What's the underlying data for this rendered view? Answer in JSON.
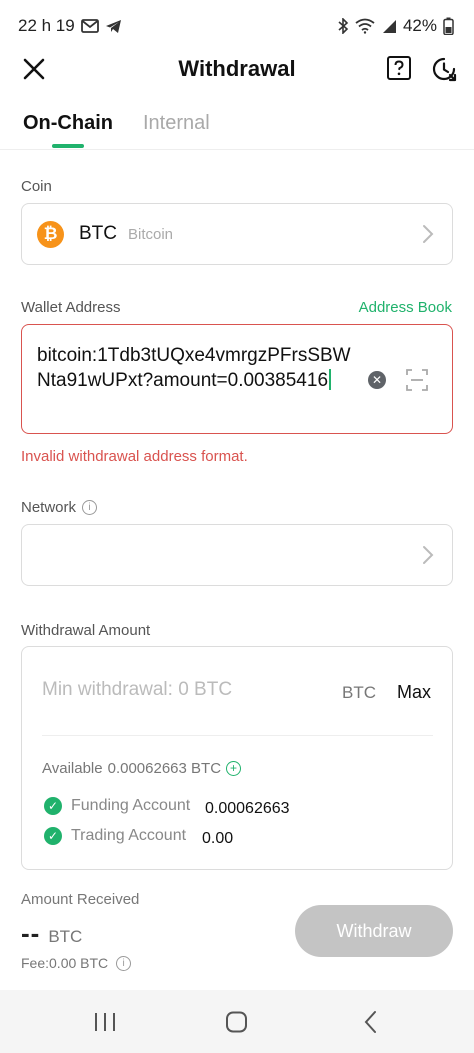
{
  "status_bar": {
    "time": "22 h 19",
    "battery": "42%",
    "left_icons": [
      "gmail-icon",
      "telegram-icon"
    ],
    "right_icons": [
      "bluetooth-icon",
      "wifi-icon",
      "signal-icon",
      "battery-icon"
    ]
  },
  "header": {
    "title": "Withdrawal"
  },
  "tabs": [
    {
      "label": "On-Chain",
      "active": true
    },
    {
      "label": "Internal",
      "active": false
    }
  ],
  "coin": {
    "label": "Coin",
    "symbol": "BTC",
    "name": "Bitcoin"
  },
  "wallet": {
    "label": "Wallet Address",
    "address_book_label": "Address Book",
    "address_value": "bitcoin:1Tdb3tUQxe4vmrgzPFrsSBWNta91wUPxt?amount=0.00385416",
    "error": "Invalid withdrawal address format."
  },
  "network": {
    "label": "Network"
  },
  "amount": {
    "label": "Withdrawal Amount",
    "placeholder": "Min withdrawal: 0 BTC",
    "unit": "BTC",
    "max_label": "Max",
    "available_label": "Available",
    "available_value": "0.00062663 BTC",
    "accounts": [
      {
        "label": "Funding Account",
        "value": "0.00062663"
      },
      {
        "label": "Trading Account",
        "value": "0.00"
      }
    ]
  },
  "received": {
    "label": "Amount Received",
    "value": "--",
    "unit": "BTC",
    "fee": "Fee:0.00 BTC"
  },
  "withdraw_button": "Withdraw",
  "colors": {
    "accent": "#20b26c",
    "error": "#d9534f",
    "btc": "#f7931a",
    "disabled": "#c4c4c4"
  }
}
